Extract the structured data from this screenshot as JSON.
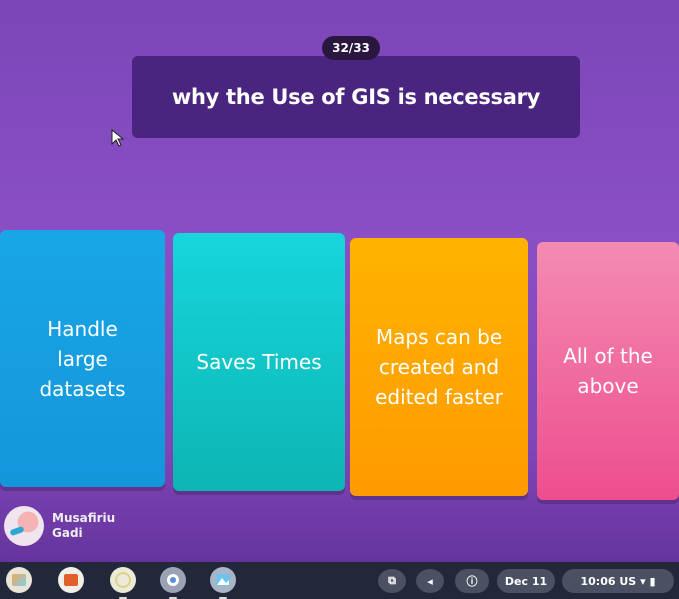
{
  "quiz": {
    "progress": "32/33",
    "question": "why the Use of GIS is necessary",
    "answers": [
      {
        "label": "Handle large datasets",
        "lines": [
          "Handle",
          "large",
          "datasets"
        ],
        "color": "#1aa3e3"
      },
      {
        "label": "Saves Times",
        "lines": [
          "Saves Times"
        ],
        "color": "#12c6c8"
      },
      {
        "label": "Maps can be created and edited faster",
        "lines": [
          "Maps can be",
          "created and",
          "edited faster"
        ],
        "color": "#ffa600"
      },
      {
        "label": "All of the above",
        "lines": [
          "All of the",
          "above"
        ],
        "color": "#ee5d97"
      }
    ]
  },
  "player": {
    "name_line1": "Musafiriu",
    "name_line2": "Gadi"
  },
  "shelf": {
    "apps": [
      "gallery-app-icon",
      "slides-app-icon",
      "lemon-app-icon",
      "settings-icon",
      "photos-icon"
    ],
    "date": "Dec 11",
    "time": "10:06",
    "locale": "US"
  }
}
